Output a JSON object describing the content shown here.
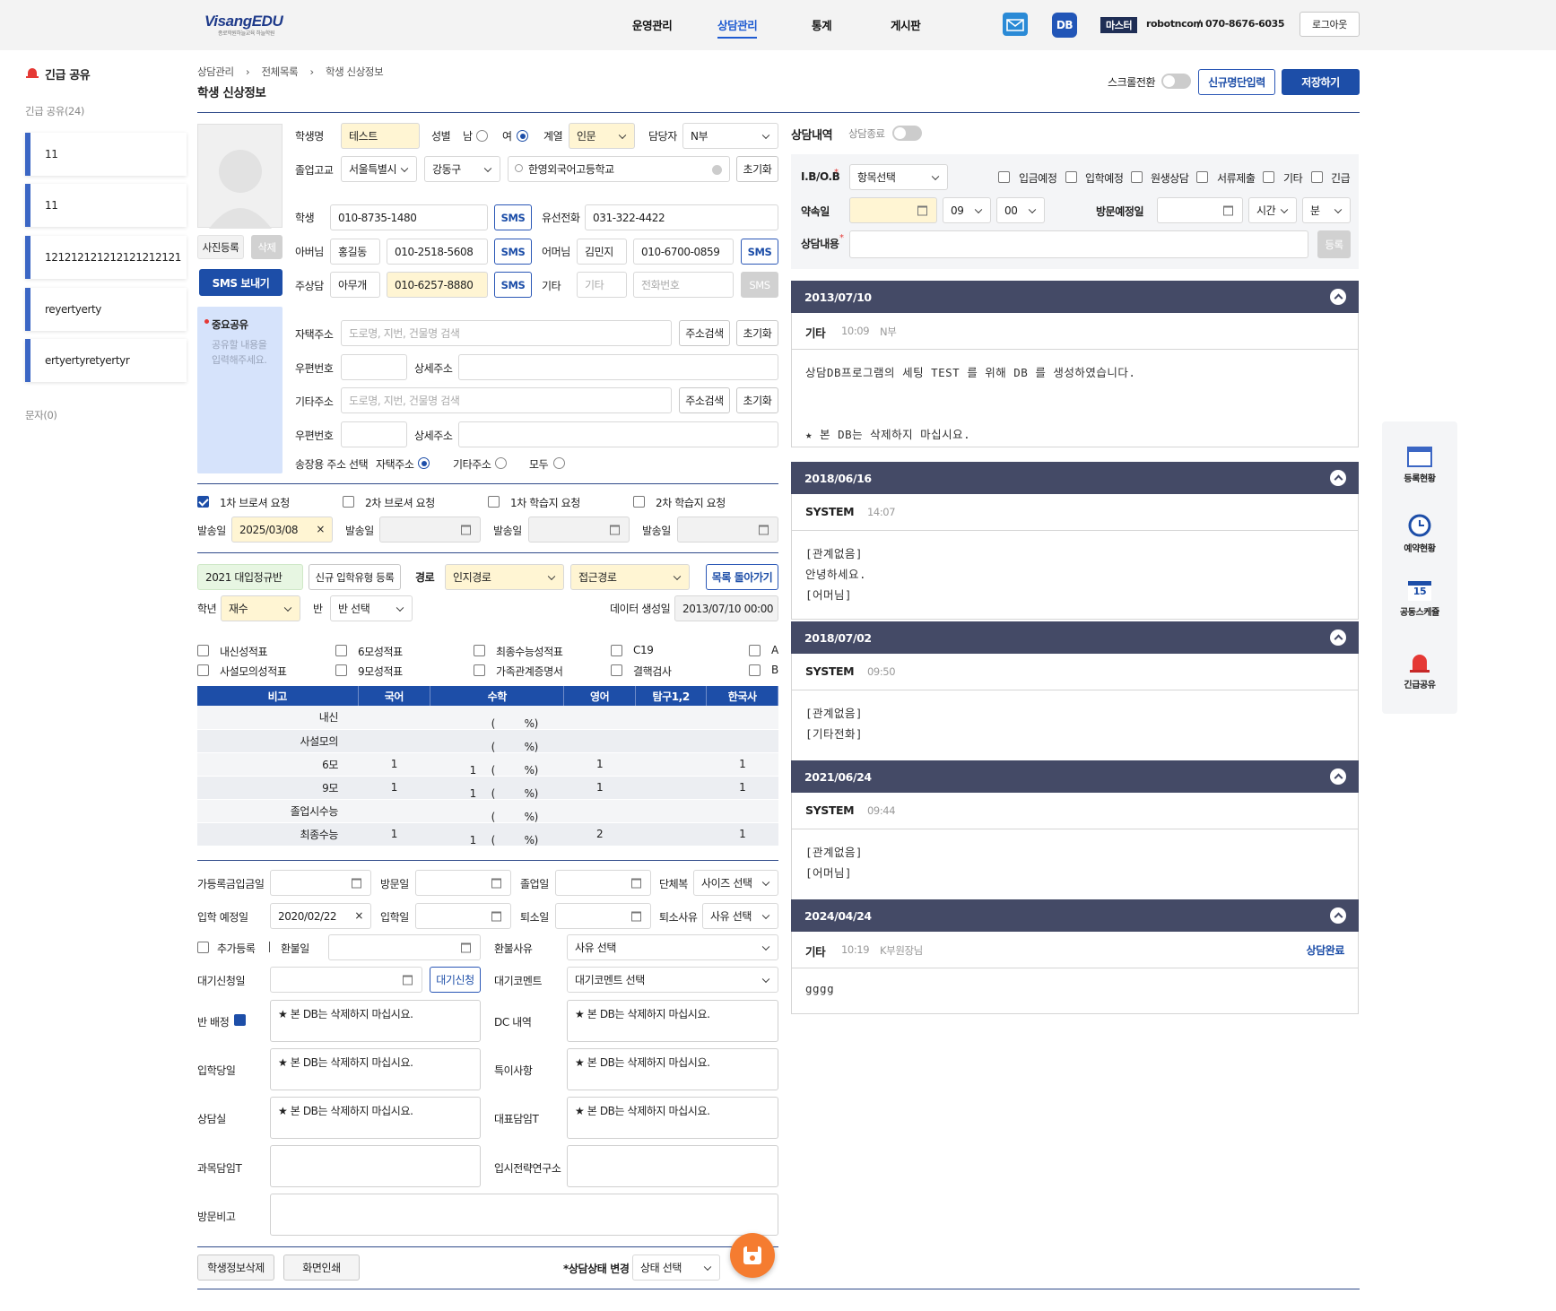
{
  "header": {
    "logo": "VisangEDU",
    "logo_sub": "종로학원하늘교육 하늘학원",
    "nav": [
      "운영관리",
      "상담관리",
      "통계",
      "게시판"
    ],
    "db_badge": "DB",
    "role": "마스터",
    "user": "robotncom",
    "phone": "070-8676-6035",
    "logout": "로그아웃"
  },
  "sidebar": {
    "title": "긴급 공유",
    "count_label": "긴급 공유(24)",
    "items": [
      "11",
      "11",
      "121212121212121212121",
      "reyertyerty",
      "ertyertyretyertyr"
    ],
    "sms_count": "문자(0)"
  },
  "page": {
    "breadcrumb": [
      "상담관리",
      "전체목록",
      "학생 신상정보"
    ],
    "title": "학생 신상정보",
    "scroll_toggle": "스크롤전환",
    "new_button": "신규명단입력",
    "save_button": "저장하기"
  },
  "student": {
    "photo_register": "사진등록",
    "photo_delete": "삭제",
    "sms_send": "SMS 보내기",
    "memo_title": "중요공유",
    "memo_placeholder": "공유할 내용을 입력해주세요.",
    "name_label": "학생명",
    "name": "테스트",
    "gender_label": "성별",
    "male": "남",
    "female": "여",
    "gender": "여",
    "track_label": "계열",
    "track": "인문",
    "manager_label": "담당자",
    "manager": "N부",
    "school_label": "졸업고교",
    "region1": "서울특별시",
    "region2": "강동구",
    "school": "한영외국어고등학교",
    "reset": "초기화",
    "student_label": "학생",
    "student_phone": "010-8735-1480",
    "sms": "SMS",
    "home_label": "유선전화",
    "home_phone": "031-322-4422",
    "father_label": "아버님",
    "father_name": "홍길동",
    "father_phone": "010-2518-5608",
    "mother_label": "어머님",
    "mother_name": "김민지",
    "mother_phone": "010-6700-0859",
    "main_label": "주상담",
    "main_name": "아무개",
    "main_phone": "010-6257-8880",
    "etc_label": "기타",
    "etc_placeholder": "기타",
    "etc_phone_placeholder": "전화번호",
    "home_addr_label": "자택주소",
    "addr_placeholder": "도로명, 지번, 건물명 검색",
    "addr_search": "주소검색",
    "zip_label": "우편번호",
    "detail_label": "상세주소",
    "other_addr_label": "기타주소",
    "delivery_label": "송장용 주소 선택",
    "delivery_home": "자택주소",
    "delivery_other": "기타주소",
    "delivery_all": "모두"
  },
  "requests": {
    "items": [
      "1차 브로셔 요청",
      "2차 브로셔 요청",
      "1차 학습지 요청",
      "2차 학습지 요청"
    ],
    "checked": [
      true,
      false,
      false,
      false
    ],
    "send_label": "발송일",
    "send_date": "2025/03/08"
  },
  "admission": {
    "class": "2021 대입정규반",
    "new_type": "신규 입학유형 등록",
    "route_label": "경로",
    "route": "인지경로",
    "contact": "접근경로",
    "back_list": "목록 돌아가기",
    "grade_label": "학년",
    "grade": "재수",
    "ban_label": "반",
    "ban": "반 선택",
    "created_label": "데이터 생성일",
    "created": "2013/07/10 00:00"
  },
  "docs": {
    "row1": [
      "내신성적표",
      "6모성적표",
      "최종수능성적표",
      "C19",
      "A"
    ],
    "row2": [
      "사설모의성적표",
      "9모성적표",
      "가족관계증명서",
      "결핵검사",
      "B"
    ]
  },
  "scores": {
    "headers": [
      "비고",
      "국어",
      "수학",
      "영어",
      "탐구1,2",
      "한국사"
    ],
    "rows": [
      {
        "name": "내신",
        "kor": "",
        "math": "",
        "eng": "",
        "tam": "",
        "hist": ""
      },
      {
        "name": "사설모의",
        "kor": "",
        "math": "",
        "eng": "",
        "tam": "",
        "hist": ""
      },
      {
        "name": "6모",
        "kor": "1",
        "math": "1",
        "eng": "1",
        "tam": "",
        "hist": "1"
      },
      {
        "name": "9모",
        "kor": "1",
        "math": "1",
        "eng": "1",
        "tam": "",
        "hist": "1"
      },
      {
        "name": "졸업시수능",
        "kor": "",
        "math": "",
        "eng": "",
        "tam": "",
        "hist": ""
      },
      {
        "name": "최종수능",
        "kor": "1",
        "math": "1",
        "eng": "2",
        "tam": "",
        "hist": "1"
      }
    ],
    "paren_open": "(",
    "paren_close": "%)"
  },
  "enroll": {
    "pre_pay": "가등록금입금일",
    "visit": "방문일",
    "grad": "졸업일",
    "uniform": "단체복",
    "size": "사이즈 선택",
    "expect": "입학 예정일",
    "expect_date": "2020/02/22",
    "enter": "입학일",
    "leave": "퇴소일",
    "leave_reason": "퇴소사유",
    "reason_sel": "사유 선택",
    "extra": "추가등록",
    "refund": "환불일",
    "refund_reason": "환불사유",
    "wait_apply": "대기신청일",
    "wait_btn": "대기신청",
    "wait_comment": "대기코멘트",
    "wait_sel": "대기코멘트 선택",
    "ban_assign": "반 배정",
    "dc": "DC 내역",
    "enter_day": "입학당일",
    "special": "특이사항",
    "room": "상담실",
    "rep_t": "대표담임T",
    "subj_t": "과목담임T",
    "strategy": "입시전략연구소",
    "visit_note": "방문비고",
    "note_text": "★ 본 DB는 삭제하지 마십시요."
  },
  "footer": {
    "delete": "학생정보삭제",
    "print": "화면인쇄",
    "status_label": "*상담상태 변경",
    "status_sel": "상태 선택"
  },
  "consult": {
    "title": "상담내역",
    "end_label": "상담종료",
    "iob_label": "I.B/O.B",
    "iob_sel": "항목선택",
    "checks": [
      "입금예정",
      "입학예정",
      "원생상담",
      "서류제출",
      "기타",
      "긴급"
    ],
    "appoint_label": "약속일",
    "hour": "09",
    "minute": "00",
    "visit_label": "방문예정일",
    "time_sel": "시간",
    "min_sel": "분",
    "content_label": "상담내용",
    "register": "등록",
    "entries": [
      {
        "date": "2013/07/10",
        "type": "기타",
        "time": "10:09",
        "by": "N부",
        "status": "",
        "lines": [
          "상담DB프로그램의 세팅 TEST 를 위해 DB 를 생성하였습니다.",
          "",
          "",
          "★ 본 DB는 삭제하지 마십시요."
        ]
      },
      {
        "date": "2018/06/16",
        "type": "SYSTEM",
        "time": "14:07",
        "by": "",
        "status": "",
        "lines": [
          "[관계없음]",
          "안녕하세요.",
          "[어머님]"
        ]
      },
      {
        "date": "2018/07/02",
        "type": "SYSTEM",
        "time": "09:50",
        "by": "",
        "status": "",
        "lines": [
          "[관계없음]",
          "[기타전화]"
        ]
      },
      {
        "date": "2021/06/24",
        "type": "SYSTEM",
        "time": "09:44",
        "by": "",
        "status": "",
        "lines": [
          "[관계없음]",
          "[어머님]"
        ]
      },
      {
        "date": "2024/04/24",
        "type": "기타",
        "time": "10:19",
        "by": "K부원장님",
        "status": "상담완료",
        "lines": [
          "gggg"
        ]
      }
    ]
  },
  "right_bar": [
    "등록현황",
    "예약현황",
    "공동스케쥴",
    "긴급공유"
  ],
  "calendar_day": "15",
  "colors": {
    "primary": "#1d4ea8",
    "panel": "#444a66",
    "yellow": "#fff5d3",
    "green": "#e7f6e2"
  }
}
